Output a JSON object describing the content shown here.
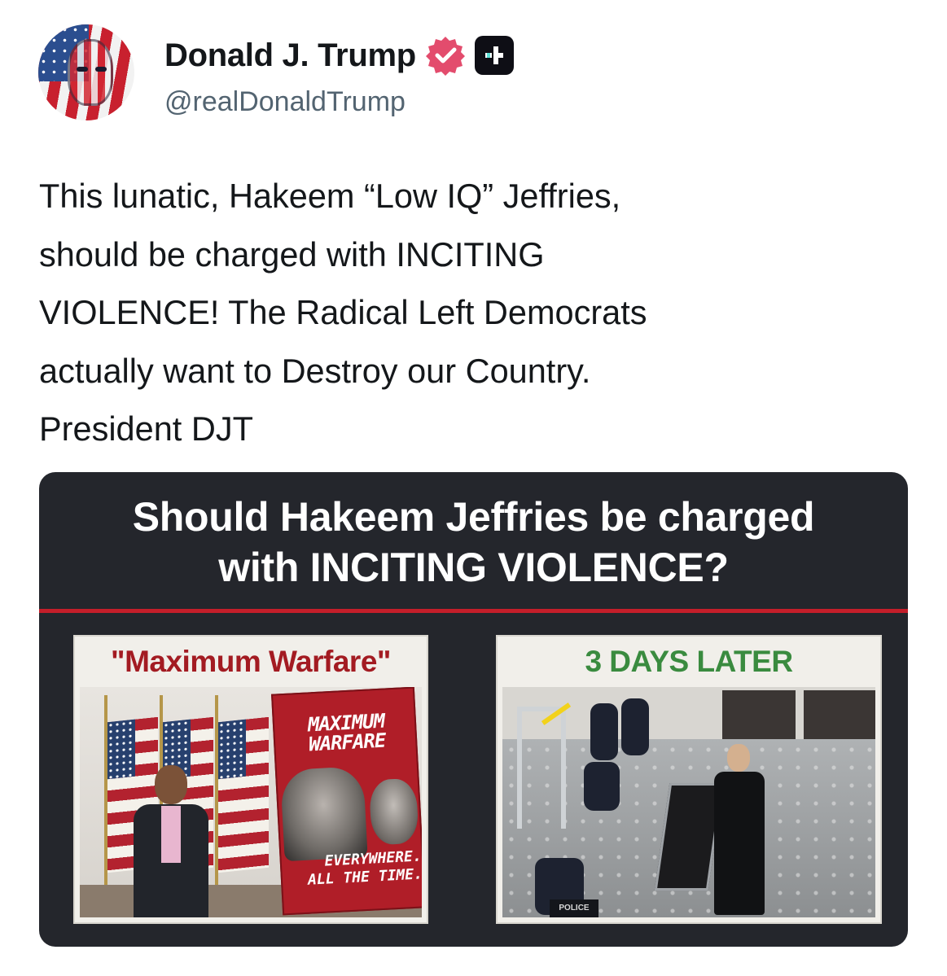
{
  "author": {
    "display_name": "Donald J. Trump",
    "handle": "@realDonaldTrump",
    "avatar": "avatar-flag-portrait",
    "verified_icon": "verified-badge-icon",
    "platform_icon": "truth-social-icon",
    "verified_color": "#e34c6d"
  },
  "post": {
    "text": "This lunatic, Hakeem “Low IQ” Jeffries,\nshould be charged with INCITING\nVIOLENCE! The Radical Left Democrats\nactually want to Destroy our Country.\nPresident DJT"
  },
  "media": {
    "headline": "Should Hakeem Jeffries be charged\nwith INCITING VIOLENCE?",
    "accent_color": "#c41e2a",
    "left_panel": {
      "caption": "\"Maximum Warfare\"",
      "caption_color": "#a31b22",
      "poster_title": "MAXIMUM\nWARFARE",
      "poster_subtitle": "EVERYWHERE.\nALL THE TIME."
    },
    "right_panel": {
      "caption": "3 DAYS LATER",
      "caption_color": "#3a8b3f",
      "badge_text": "POLICE"
    }
  }
}
